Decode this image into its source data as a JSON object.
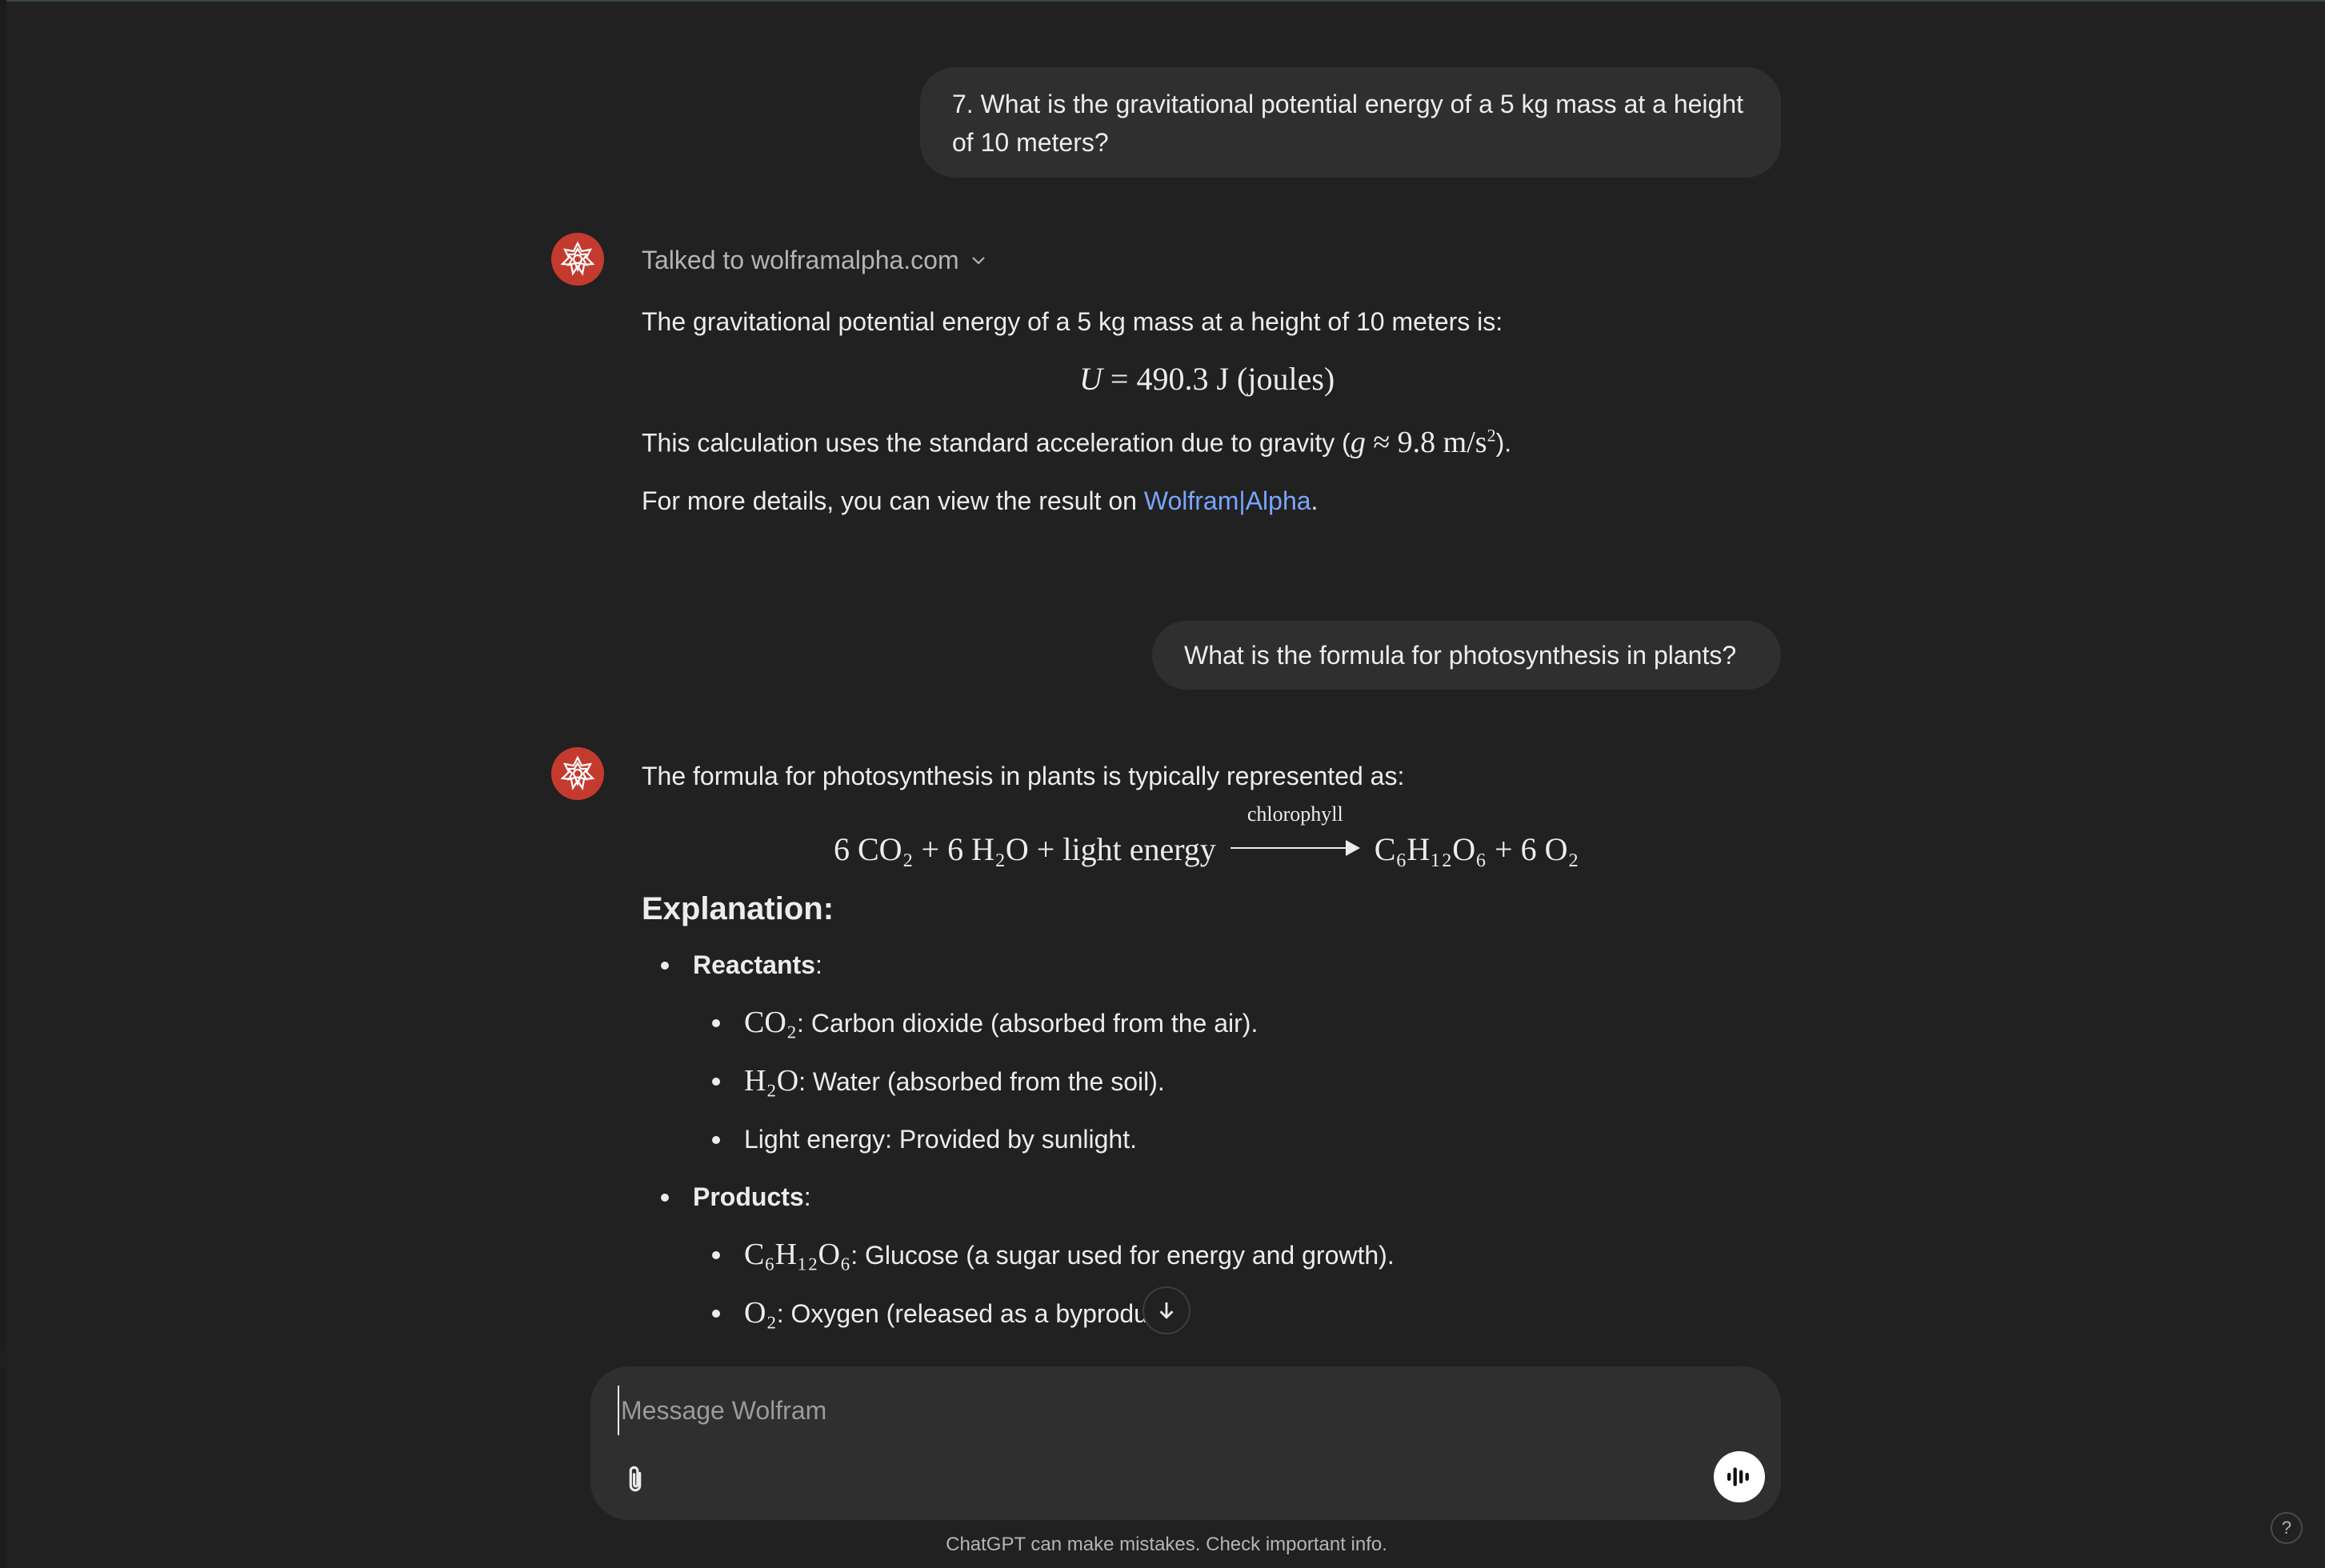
{
  "conversation": {
    "user_msg_1": "7. What is the gravitational potential energy of a 5 kg mass at a height of 10 meters?",
    "assistant_1": {
      "tool_call_label": "Talked to wolframalpha.com",
      "intro": "The gravitational potential energy of a 5 kg mass at a height of 10 meters is:",
      "equation": {
        "var": "U",
        "value": "490.3",
        "unit": "J",
        "unit_name": "(joules)"
      },
      "gravity_prefix": "This calculation uses the standard acceleration due to gravity (",
      "gravity_math": {
        "var": "g",
        "approx": "≈",
        "value": "9.8",
        "unit": "m/s",
        "exp": "2"
      },
      "gravity_suffix": ").",
      "details_prefix": "For more details, you can view the result on ",
      "details_link": "Wolfram|Alpha",
      "details_suffix": "."
    },
    "user_msg_2": "What is the formula for photosynthesis in plants?",
    "assistant_2": {
      "intro": "The formula for photosynthesis in plants is typically represented as:",
      "equation": {
        "reactants": "6 CO₂ + 6 H₂O + light energy",
        "arrow_label": "chlorophyll",
        "products": "C₆H₁₂O₆ + 6 O₂"
      },
      "heading": "Explanation:",
      "reactants_label": "Reactants",
      "reactants": [
        {
          "chem": "CO₂",
          "desc": ": Carbon dioxide (absorbed from the air)."
        },
        {
          "chem": "H₂O",
          "desc": ": Water (absorbed from the soil)."
        },
        {
          "text": "Light energy: Provided by sunlight."
        }
      ],
      "products_label": "Products",
      "products": [
        {
          "chem": "C₆H₁₂O₆",
          "desc": ": Glucose (a sugar used for energy and growth)."
        },
        {
          "chem": "O₂",
          "desc": ": Oxygen (released as a byproduct)."
        }
      ]
    }
  },
  "composer": {
    "placeholder": "Message Wolfram"
  },
  "footer": {
    "disclaimer": "ChatGPT can make mistakes. Check important info.",
    "help": "?"
  },
  "icons": {
    "avatar": "wolfram-logo-icon",
    "chevron": "chevron-down-icon",
    "scroll": "arrow-down-icon",
    "attach": "paperclip-icon",
    "voice": "voice-mode-icon"
  },
  "colors": {
    "background": "#212121",
    "bubble": "#2f2f2f",
    "link": "#7aa5ff",
    "avatar": "#c53a2e"
  }
}
